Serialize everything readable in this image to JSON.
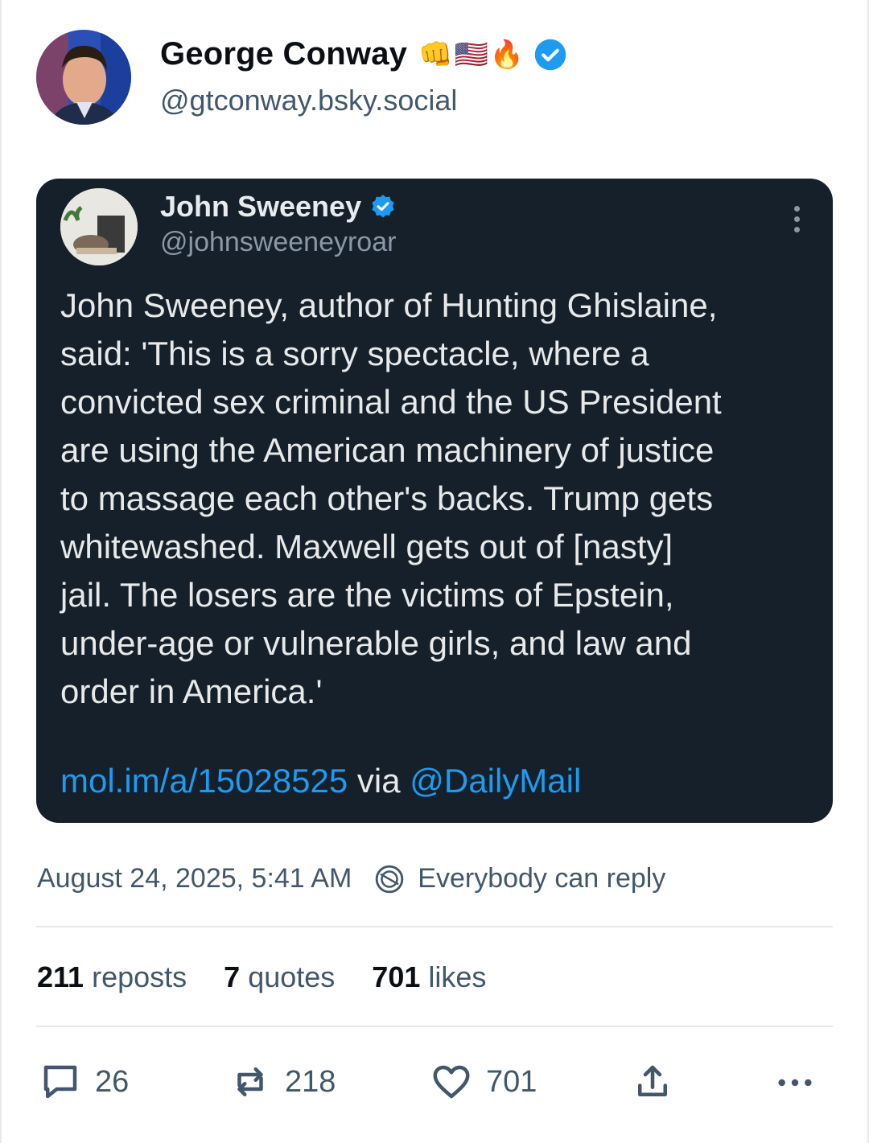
{
  "post": {
    "author_name": "George Conway",
    "author_emoji": "👊🇺🇸🔥",
    "author_handle": "@gtconway.bsky.social",
    "timestamp": "August 24, 2025, 5:41 AM",
    "reply_setting": "Everybody can reply"
  },
  "embed": {
    "name": "John Sweeney",
    "handle": "@johnsweeneyroar",
    "text": "John Sweeney, author of Hunting Ghislaine,\nsaid: 'This is a sorry spectacle, where a\nconvicted sex criminal and the US President\nare using the American machinery of justice\nto massage each other's backs. Trump gets\nwhitewashed. Maxwell gets out of [nasty]\njail. The losers are the victims of Epstein,\nunder-age or vulnerable girls, and law and\norder in America.'",
    "link": "mol.im/a/15028525",
    "via": "via",
    "mention": "@DailyMail"
  },
  "stats": {
    "reposts_num": "211",
    "reposts_label": "reposts",
    "quotes_num": "7",
    "quotes_label": "quotes",
    "likes_num": "701",
    "likes_label": "likes"
  },
  "actions": {
    "replies": "26",
    "reposts": "218",
    "likes": "701"
  },
  "colors": {
    "card_bg": "#15202b",
    "link": "#1d9bf0",
    "verified": "#1d9bf0"
  }
}
